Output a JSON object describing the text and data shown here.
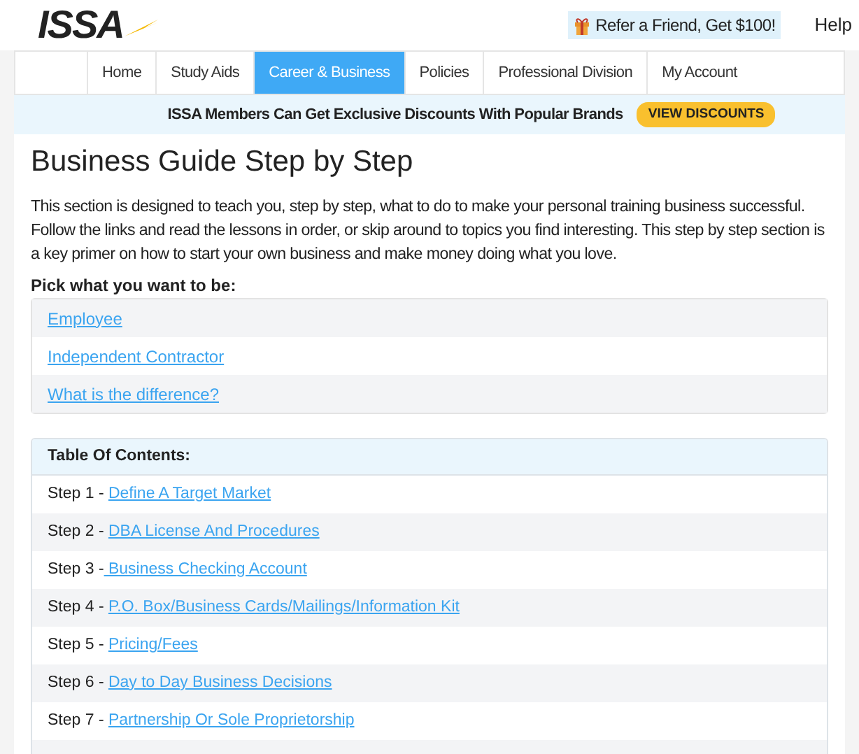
{
  "header": {
    "logo": "ISSA",
    "refer_button": "Refer a Friend, Get $100!",
    "help_link": "Help"
  },
  "nav": {
    "tabs": [
      {
        "label": "Home",
        "selected": false
      },
      {
        "label": "Study Aids",
        "selected": false
      },
      {
        "label": "Career & Business",
        "selected": true
      },
      {
        "label": "Policies",
        "selected": false
      },
      {
        "label": "Professional Division",
        "selected": false
      },
      {
        "label": "My Account",
        "selected": false
      }
    ]
  },
  "banner": {
    "text": "ISSA Members Can Get Exclusive Discounts With Popular Brands",
    "button": "VIEW DISCOUNTS"
  },
  "title": "Business Guide Step by Step",
  "intro": "This section is designed to teach you, step by step, what to do to make your personal training business successful. Follow the links and read the lessons in order, or skip around to topics you find interesting. This step by step section is a key primer on how to start your own business and make money doing what you love.",
  "pick_label": "Pick what you want to be:",
  "options": [
    "Employee",
    "Independent Contractor",
    "What is the difference?"
  ],
  "toc": {
    "heading": "Table Of Contents:",
    "steps": [
      {
        "label": "Step 1 - ",
        "link": "Define A Target Market"
      },
      {
        "label": "Step 2 - ",
        "link": "DBA License And Procedures"
      },
      {
        "label": "Step 3 -",
        "link": " Business Checking Account"
      },
      {
        "label": "Step 4 - ",
        "link": "P.O. Box/Business Cards/Mailings/Information Kit"
      },
      {
        "label": "Step 5 - ",
        "link": "Pricing/Fees"
      },
      {
        "label": "Step 6 - ",
        "link": "Day to Day Business Decisions"
      },
      {
        "label": "Step 7 - ",
        "link": "Partnership Or Sole Proprietorship"
      }
    ]
  }
}
